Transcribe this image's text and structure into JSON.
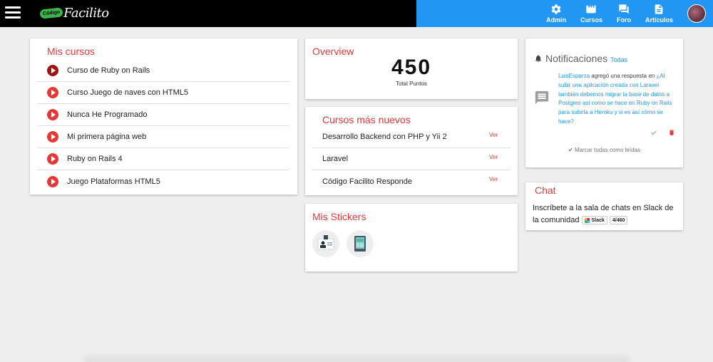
{
  "header": {
    "logo_badge": "Código",
    "logo_text": "Facilito",
    "nav": [
      {
        "label": "Admin",
        "icon": "gear-icon"
      },
      {
        "label": "Cursos",
        "icon": "film-icon"
      },
      {
        "label": "Foro",
        "icon": "forum-icon"
      },
      {
        "label": "Artículos",
        "icon": "document-icon"
      }
    ],
    "colors": {
      "left_bar": "#000000",
      "right_bar": "#2196f3"
    }
  },
  "mis_cursos": {
    "title": "Mis cursos",
    "items": [
      "Curso de Ruby on Rails",
      "Curso Juego de naves con HTML5",
      "Nunca He Programado",
      "Mi primera página web",
      "Ruby on Rails 4",
      "Juego Plataformas HTML5"
    ]
  },
  "overview": {
    "title": "Overview",
    "points": "450",
    "points_label": "Total Puntos"
  },
  "cursos_nuevos": {
    "title": "Cursos más nuevos",
    "items": [
      {
        "name": "Desarrollo Backend con PHP y Yii 2",
        "action": "Ver"
      },
      {
        "name": "Laravel",
        "action": "Ver"
      },
      {
        "name": "Código Facilito Responde",
        "action": "Ver"
      }
    ]
  },
  "stickers": {
    "title": "Mis Stickers"
  },
  "notificaciones": {
    "title": "Notificaciones",
    "all_link": "Todas",
    "user": "LuisEsparza",
    "verb": "agregó una respuesta en",
    "topic": "¿Al subir una aplicación creada con Laravel también debemos migrar la base de datos a Postgres así como se hace en Ruby on Rails para subirla a Heroku y si es así cómo se hace?",
    "mark_all": "Marcar todas como leídas"
  },
  "chat": {
    "title": "Chat",
    "text": "Inscríbete a la sala de chats en Slack de la comunidad",
    "slack_label": "Slack",
    "count": "4/460"
  },
  "accent": "#e53935"
}
